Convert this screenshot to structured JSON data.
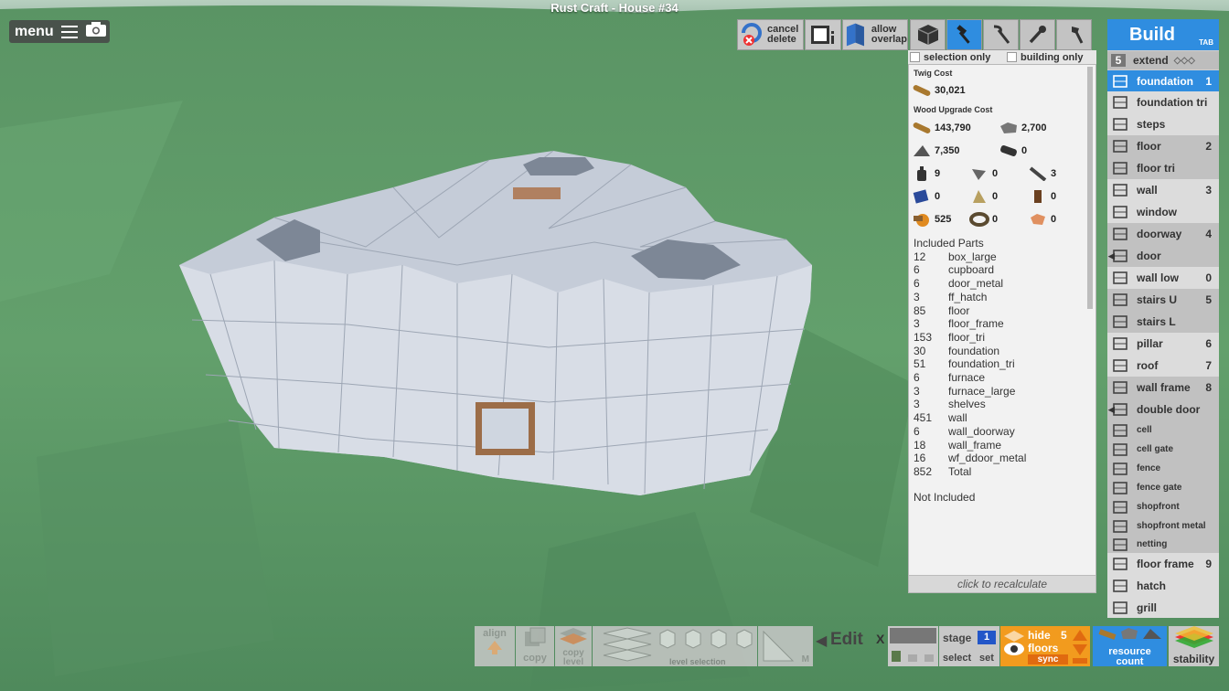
{
  "window_title": "Rust Craft - House #34",
  "menu": {
    "label": "menu",
    "menu_icon": "hamburger-icon",
    "camera_icon": "camera-icon"
  },
  "toolbar": {
    "cancel_delete": [
      "cancel",
      "delete"
    ],
    "allow_overlap": [
      "allow",
      "overlap"
    ],
    "tools": [
      "cube-icon",
      "hammer-icon",
      "pickaxe-icon",
      "wrench-icon",
      "hatchet-icon"
    ]
  },
  "filters": {
    "selection_only": "selection only",
    "building_only": "building only"
  },
  "costs": {
    "twig_header": "Twig Cost",
    "twig": [
      {
        "icon": "wood-icon",
        "value": "30,021"
      }
    ],
    "wood_header": "Wood Upgrade Cost",
    "wood": [
      {
        "icon": "wood-icon",
        "value": "143,790"
      },
      {
        "icon": "stone-icon",
        "value": "2,700"
      },
      {
        "icon": "metal-fragments-icon",
        "value": "7,350"
      },
      {
        "icon": "hq-metal-icon",
        "value": "0"
      },
      {
        "icon": "low-grade-fuel-icon",
        "value": "9"
      },
      {
        "icon": "metal-blade-icon",
        "value": "0"
      },
      {
        "icon": "metal-pipe-icon",
        "value": "3"
      },
      {
        "icon": "blueprint-icon",
        "value": "0"
      },
      {
        "icon": "cloth-icon",
        "value": "0"
      },
      {
        "icon": "gear-icon",
        "value": "0"
      },
      {
        "icon": "charcoal-icon",
        "value": "525"
      },
      {
        "icon": "rope-icon",
        "value": "0"
      },
      {
        "icon": "leather-icon",
        "value": "0"
      }
    ]
  },
  "included_parts": {
    "header": "Included Parts",
    "rows": [
      {
        "qty": "12",
        "name": "box_large"
      },
      {
        "qty": "6",
        "name": "cupboard"
      },
      {
        "qty": "6",
        "name": "door_metal"
      },
      {
        "qty": "3",
        "name": "ff_hatch"
      },
      {
        "qty": "85",
        "name": "floor"
      },
      {
        "qty": "3",
        "name": "floor_frame"
      },
      {
        "qty": "153",
        "name": "floor_tri"
      },
      {
        "qty": "30",
        "name": "foundation"
      },
      {
        "qty": "51",
        "name": "foundation_tri"
      },
      {
        "qty": "6",
        "name": "furnace"
      },
      {
        "qty": "3",
        "name": "furnace_large"
      },
      {
        "qty": "3",
        "name": "shelves"
      },
      {
        "qty": "451",
        "name": "wall"
      },
      {
        "qty": "6",
        "name": "wall_doorway"
      },
      {
        "qty": "18",
        "name": "wall_frame"
      },
      {
        "qty": "16",
        "name": "wf_ddoor_metal"
      },
      {
        "qty": "852",
        "name": "Total"
      }
    ],
    "not_included": "Not Included",
    "recalc": "click to recalculate"
  },
  "build": {
    "title": "Build",
    "tab_hint": "TAB",
    "extend_count": "5",
    "extend_label": "extend",
    "items": [
      {
        "label": "foundation",
        "num": "1",
        "icon": "foundation-icon"
      },
      {
        "label": "foundation tri",
        "num": "",
        "icon": "foundation-tri-icon"
      },
      {
        "label": "steps",
        "num": "",
        "icon": "steps-icon"
      },
      {
        "label": "floor",
        "num": "2",
        "icon": "floor-icon"
      },
      {
        "label": "floor tri",
        "num": "",
        "icon": "floor-tri-icon"
      },
      {
        "label": "wall",
        "num": "3",
        "icon": "wall-icon"
      },
      {
        "label": "window",
        "num": "",
        "icon": "window-icon"
      },
      {
        "label": "doorway",
        "num": "4",
        "icon": "doorway-icon"
      },
      {
        "label": "door",
        "num": "",
        "icon": "door-icon"
      },
      {
        "label": "wall low",
        "num": "0",
        "icon": "wall-low-icon"
      },
      {
        "label": "stairs U",
        "num": "5",
        "icon": "stairs-u-icon"
      },
      {
        "label": "stairs L",
        "num": "",
        "icon": "stairs-l-icon"
      },
      {
        "label": "pillar",
        "num": "6",
        "icon": "pillar-icon"
      },
      {
        "label": "roof",
        "num": "7",
        "icon": "roof-icon"
      },
      {
        "label": "wall frame",
        "num": "8",
        "icon": "wall-frame-icon"
      },
      {
        "label": "double door",
        "num": "",
        "icon": "double-door-icon"
      },
      {
        "label": "cell",
        "num": "",
        "icon": "cell-icon"
      },
      {
        "label": "cell gate",
        "num": "",
        "icon": "cell-gate-icon"
      },
      {
        "label": "fence",
        "num": "",
        "icon": "fence-icon"
      },
      {
        "label": "fence gate",
        "num": "",
        "icon": "fence-gate-icon"
      },
      {
        "label": "shopfront",
        "num": "",
        "icon": "shopfront-icon"
      },
      {
        "label": "shopfront metal",
        "num": "",
        "icon": "shopfront-metal-icon"
      },
      {
        "label": "netting",
        "num": "",
        "icon": "netting-icon"
      },
      {
        "label": "floor frame",
        "num": "9",
        "icon": "floor-frame-icon"
      },
      {
        "label": "hatch",
        "num": "",
        "icon": "hatch-icon"
      },
      {
        "label": "grill",
        "num": "",
        "icon": "grill-icon"
      }
    ]
  },
  "bottom": {
    "align": "align",
    "copy": "copy",
    "copy_level": [
      "copy",
      "level"
    ],
    "level_selection": "level selection",
    "m": "M",
    "edit": "Edit",
    "x": "X",
    "stage": "stage",
    "stage_num": "1",
    "select": "select",
    "set": "set",
    "hide_floors": [
      "hide",
      "floors"
    ],
    "floors_count": "5",
    "sync": "sync",
    "resource_count": [
      "resource",
      "count"
    ],
    "stability": "stability"
  },
  "colors": {
    "accent": "#2f8de0",
    "orange": "#f29b1e",
    "panel": "#f2f2f2",
    "grass": "#5f9a68"
  }
}
